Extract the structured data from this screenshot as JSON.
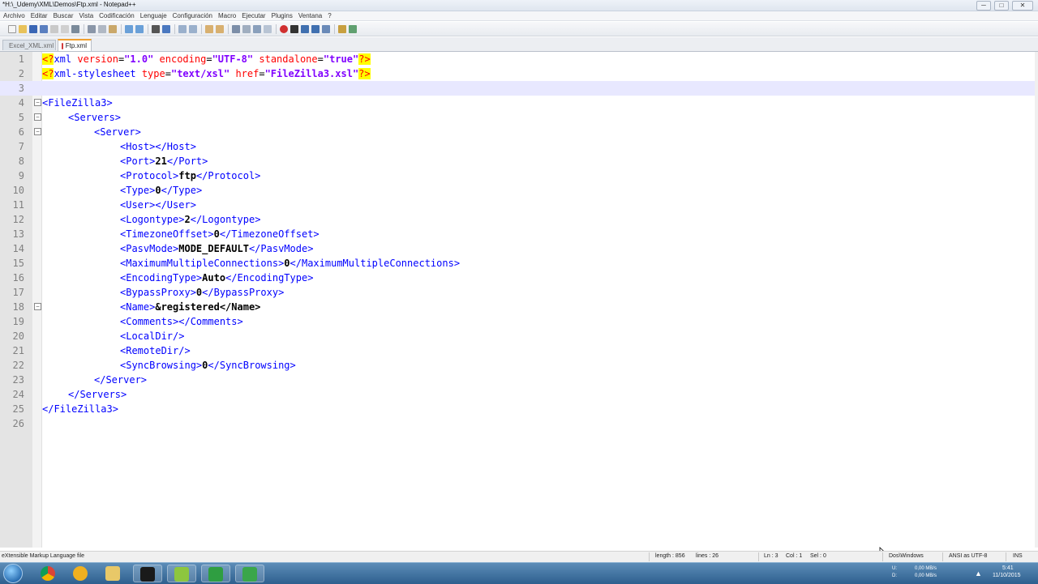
{
  "window": {
    "title": "*H:\\_Udemy\\XML\\Demos\\Ftp.xml - Notepad++",
    "controls": [
      "─",
      "□",
      "✕"
    ]
  },
  "menu": [
    "Archivo",
    "Editar",
    "Buscar",
    "Vista",
    "Codificación",
    "Lenguaje",
    "Configuración",
    "Macro",
    "Ejecutar",
    "Plugins",
    "Ventana",
    "?"
  ],
  "tabs": [
    {
      "label": "Excel_XML.xml",
      "active": false
    },
    {
      "label": "Ftp.xml",
      "active": true
    }
  ],
  "editor": {
    "current_line": 3,
    "lines": [
      {
        "n": "1",
        "fold": ""
      },
      {
        "n": "2",
        "fold": ""
      },
      {
        "n": "3",
        "fold": ""
      },
      {
        "n": "4",
        "fold": "⊟"
      },
      {
        "n": "5",
        "fold": "⊟"
      },
      {
        "n": "6",
        "fold": "⊟"
      },
      {
        "n": "7",
        "fold": ""
      },
      {
        "n": "8",
        "fold": ""
      },
      {
        "n": "9",
        "fold": ""
      },
      {
        "n": "10",
        "fold": ""
      },
      {
        "n": "11",
        "fold": ""
      },
      {
        "n": "12",
        "fold": ""
      },
      {
        "n": "13",
        "fold": ""
      },
      {
        "n": "14",
        "fold": ""
      },
      {
        "n": "15",
        "fold": ""
      },
      {
        "n": "16",
        "fold": ""
      },
      {
        "n": "17",
        "fold": ""
      },
      {
        "n": "18",
        "fold": "⊟"
      },
      {
        "n": "19",
        "fold": ""
      },
      {
        "n": "20",
        "fold": ""
      },
      {
        "n": "21",
        "fold": ""
      },
      {
        "n": "22",
        "fold": ""
      },
      {
        "n": "23",
        "fold": ""
      },
      {
        "n": "24",
        "fold": ""
      },
      {
        "n": "25",
        "fold": ""
      },
      {
        "n": "26",
        "fold": ""
      }
    ],
    "code": {
      "l1_pi_open": "<?",
      "l1_name": "xml",
      "l1_a1": " version",
      "l1_v1": "\"1.0\"",
      "l1_a2": " encoding",
      "l1_v2": "\"UTF-8\"",
      "l1_a3": " standalone",
      "l1_v3": "\"true\"",
      "l1_pi_close": "?>",
      "l2_pi_open": "<?",
      "l2_name": "xml-stylesheet",
      "l2_a1": " type",
      "l2_v1": "\"text/xsl\"",
      "l2_a2": " href",
      "l2_v2": "\"FileZilla3.xsl\"",
      "l2_pi_close": "?>",
      "eq": "=",
      "l4": "<FileZilla3>",
      "l5": "<Servers>",
      "l6": "<Server>",
      "l7": "<Host></Host>",
      "l8_o": "<Port>",
      "l8_v": "21",
      "l8_c": "</Port>",
      "l9_o": "<Protocol>",
      "l9_v": "ftp",
      "l9_c": "</Protocol>",
      "l10_o": "<Type>",
      "l10_v": "0",
      "l10_c": "</Type>",
      "l11": "<User></User>",
      "l12_o": "<Logontype>",
      "l12_v": "2",
      "l12_c": "</Logontype>",
      "l13_o": "<TimezoneOffset>",
      "l13_v": "0",
      "l13_c": "</TimezoneOffset>",
      "l14_o": "<PasvMode>",
      "l14_v": "MODE_DEFAULT",
      "l14_c": "</PasvMode>",
      "l15_o": "<MaximumMultipleConnections>",
      "l15_v": "0",
      "l15_c": "</MaximumMultipleConnections>",
      "l16_o": "<EncodingType>",
      "l16_v": "Auto",
      "l16_c": "</EncodingType>",
      "l17_o": "<BypassProxy>",
      "l17_v": "0",
      "l17_c": "</BypassProxy>",
      "l18_o": "<Name>",
      "l18_v": "&registered</Name>",
      "l19": "<Comments></Comments>",
      "l20": "<LocalDir/>",
      "l21": "<RemoteDir/>",
      "l22_o": "<SyncBrowsing>",
      "l22_v": "0",
      "l22_c": "</SyncBrowsing>",
      "l23": "</Server>",
      "l24": "</Servers>",
      "l25": "</FileZilla3>"
    }
  },
  "status": {
    "filetype": "eXtensible Markup Language file",
    "length": "length : 856",
    "lines": "lines : 26",
    "ln": "Ln : 3",
    "col": "Col : 1",
    "sel": "Sel : 0",
    "eol": "Dos\\Windows",
    "encoding": "ANSI as UTF-8",
    "mode": "INS"
  },
  "taskbar": {
    "apps": [
      "chrome",
      "audio",
      "explorer",
      "kindle",
      "notepad",
      "camtasia",
      "camtasia-recorder"
    ],
    "net_up_label": "U:",
    "net_up": "0,00 MB/s",
    "net_down_label": "D:",
    "net_down": "0,00 MB/s",
    "time": "5:41",
    "date": "11/10/2015"
  },
  "colors": {
    "tag": "#0000ff",
    "attribute": "#ff0000",
    "attr_value": "#8000ff",
    "pi_highlight": "#ffff00",
    "current_line": "#e8e8ff"
  }
}
